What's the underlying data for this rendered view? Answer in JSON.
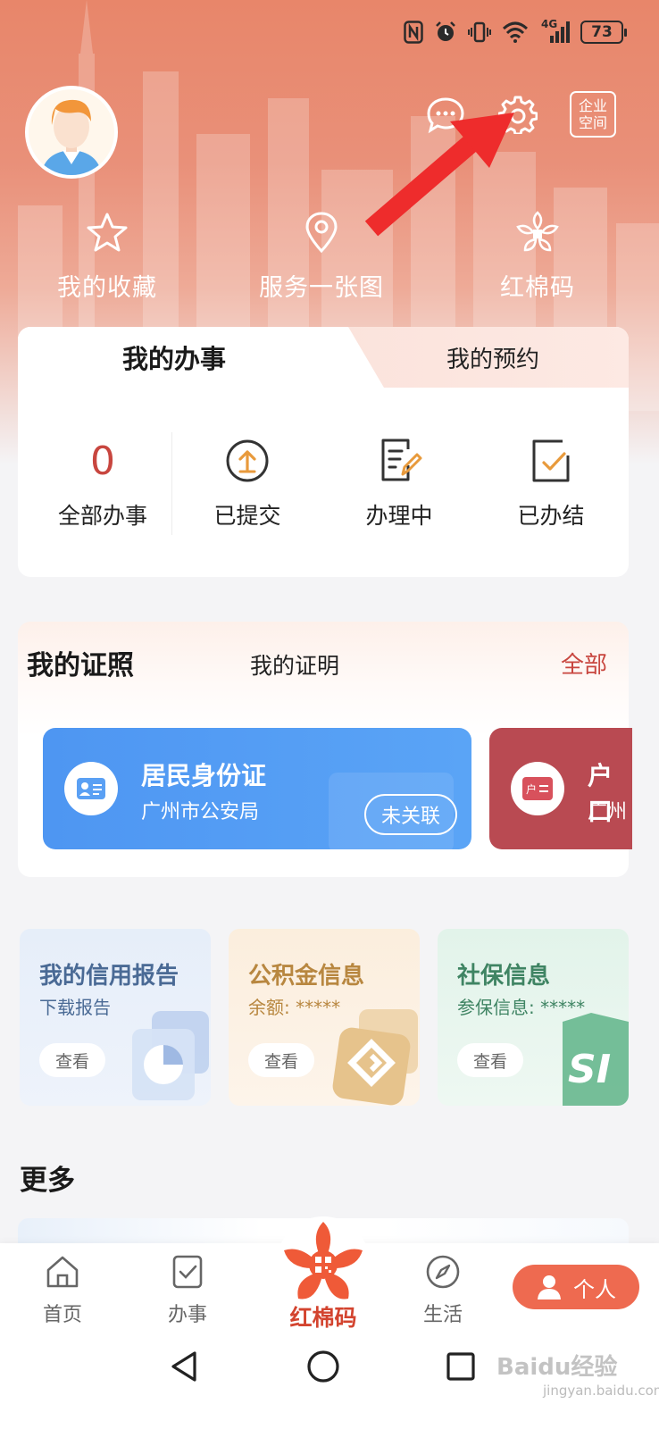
{
  "status_bar": {
    "network": "4G",
    "battery": "73"
  },
  "header": {
    "enterprise_label_line1": "企业",
    "enterprise_label_line2": "空间"
  },
  "quick_links": [
    {
      "label": "我的收藏",
      "icon": "star-icon"
    },
    {
      "label": "服务一张图",
      "icon": "location-pin-icon"
    },
    {
      "label": "红棉码",
      "icon": "kapok-flower-icon"
    }
  ],
  "tasks": {
    "tabs": [
      {
        "label": "我的办事",
        "active": true
      },
      {
        "label": "我的预约",
        "active": false
      }
    ],
    "stats": [
      {
        "value": "0",
        "label": "全部办事"
      },
      {
        "label": "已提交",
        "icon": "upload-circle-icon"
      },
      {
        "label": "办理中",
        "icon": "document-edit-icon"
      },
      {
        "label": "已办结",
        "icon": "checked-box-icon"
      }
    ]
  },
  "certificates": {
    "title": "我的证照",
    "subtitle": "我的证明",
    "all_label": "全部",
    "cards": [
      {
        "title": "居民身份证",
        "issuer": "广州市公安局",
        "action": "未关联",
        "color": "#5aa0f4",
        "icon_label": ""
      },
      {
        "title": "户口",
        "issuer": "广州",
        "icon_label": "户",
        "color": "#b94a52"
      }
    ]
  },
  "info_tiles": [
    {
      "title": "我的信用报告",
      "subtitle": "下载报告",
      "button": "查看",
      "icon": "pie-chart-icon"
    },
    {
      "title": "公积金信息",
      "subtitle": "余额: *****",
      "button": "查看",
      "icon": "housing-fund-logo-icon"
    },
    {
      "title": "社保信息",
      "subtitle": "参保信息: *****",
      "button": "查看",
      "icon": "social-security-logo-icon",
      "logo_text": "SI"
    }
  ],
  "more": {
    "title": "更多"
  },
  "bottom_nav": {
    "items": [
      {
        "label": "首页",
        "icon": "home-icon"
      },
      {
        "label": "办事",
        "icon": "checklist-icon"
      },
      {
        "label": "红棉码",
        "icon": "kapok-flower-icon"
      },
      {
        "label": "生活",
        "icon": "compass-icon"
      },
      {
        "label": "个人",
        "icon": "person-icon",
        "active": true
      }
    ]
  },
  "watermark": {
    "text": "Baidu经验",
    "sub": "jingyan.baidu.com"
  },
  "colors": {
    "accent": "#e8866a",
    "primary_red": "#c8463f",
    "id_card_blue": "#5aa0f4",
    "nav_active": "#ee6a50"
  }
}
